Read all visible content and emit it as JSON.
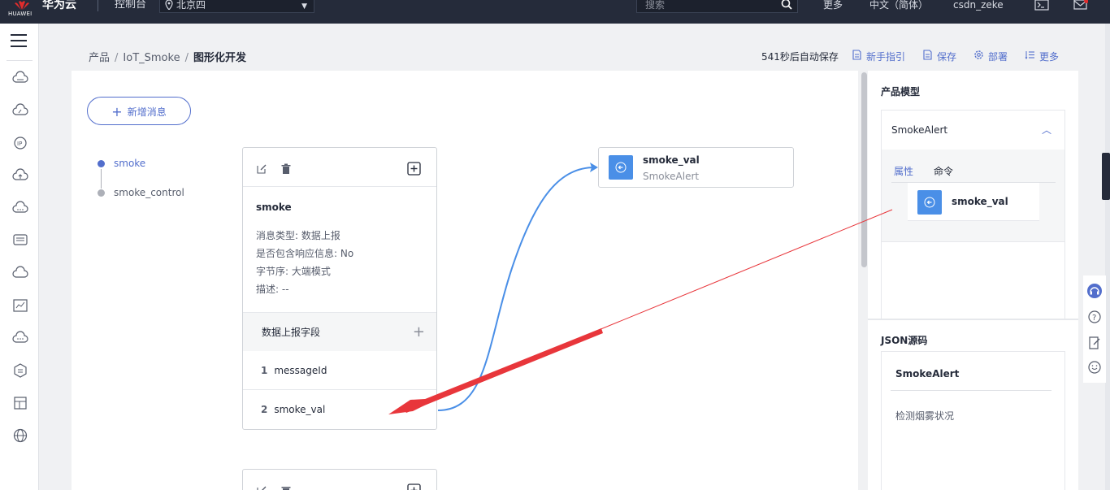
{
  "topbar": {
    "logo_text": "HUAWEI",
    "brand": "华为云",
    "console": "控制台",
    "region": "北京四",
    "search_placeholder": "搜索",
    "more": "更多",
    "lang": "中文（简体）",
    "user": "csdn_zeke"
  },
  "breadcrumb": {
    "root": "产品",
    "product": "IoT_Smoke",
    "current": "图形化开发",
    "sep": "/"
  },
  "toolbar": {
    "autosave": "541秒后自动保存",
    "guide": "新手指引",
    "save": "保存",
    "deploy": "部署",
    "more": "更多"
  },
  "canvas": {
    "add_message": "新增消息",
    "messages": [
      {
        "label": "smoke",
        "active": true
      },
      {
        "label": "smoke_control",
        "active": false
      }
    ],
    "card": {
      "title": "smoke",
      "info": [
        "消息类型: 数据上报",
        "是否包含响应信息: No",
        "字节序: 大端模式",
        "描述: --"
      ],
      "section": "数据上报字段",
      "fields": [
        {
          "no": "1",
          "name": "messageId"
        },
        {
          "no": "2",
          "name": "smoke_val"
        }
      ]
    },
    "property": {
      "name": "smoke_val",
      "model": "SmokeAlert"
    }
  },
  "right_panel": {
    "title": "产品模型",
    "service": "SmokeAlert",
    "tabs": [
      "属性",
      "命令"
    ],
    "property": "smoke_val",
    "json_title": "JSON源码",
    "json_service": "SmokeAlert",
    "json_desc": "检测烟雾状况"
  },
  "colors": {
    "accent": "#526ecc",
    "topbar": "#252b3a",
    "property_icon": "#4a8fe7",
    "annotation_arrow": "#e8363b"
  }
}
